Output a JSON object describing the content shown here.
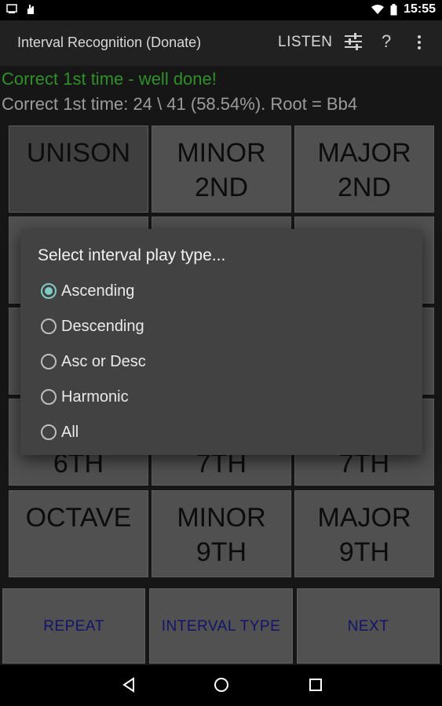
{
  "status_bar": {
    "time": "15:55"
  },
  "app_bar": {
    "title": "Interval Recognition (Donate)",
    "listen_label": "LISTEN",
    "help_label": "?"
  },
  "feedback": {
    "message": "Correct 1st time - well done!",
    "stats": "Correct 1st time: 24 \\ 41 (58.54%).  Root = Bb4"
  },
  "grid": {
    "row1": [
      [
        "UNISON",
        ""
      ],
      [
        "MINOR",
        "2ND"
      ],
      [
        "MAJOR",
        "2ND"
      ]
    ],
    "row4": [
      "6TH",
      "7TH",
      "7TH"
    ],
    "row5": [
      [
        "OCTAVE",
        ""
      ],
      [
        "MINOR",
        "9TH"
      ],
      [
        "MAJOR",
        "9TH"
      ]
    ]
  },
  "buttons": {
    "repeat": "REPEAT",
    "interval_type": "INTERVAL TYPE",
    "next": "NEXT"
  },
  "dialog": {
    "title": "Select interval play type...",
    "options": [
      "Ascending",
      "Descending",
      "Asc or Desc",
      "Harmonic",
      "All"
    ],
    "selected": "Ascending"
  },
  "colors": {
    "feedback_green": "#3fbf36",
    "button_text": "#1a1a8c",
    "radio_accent": "#80cbc4"
  }
}
